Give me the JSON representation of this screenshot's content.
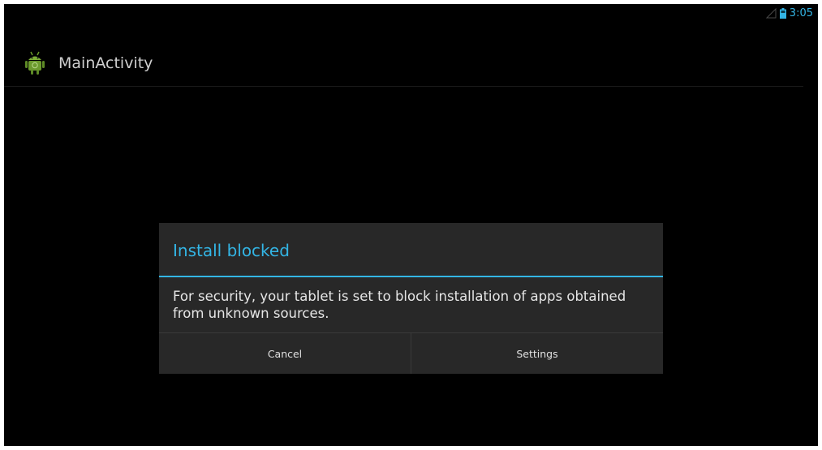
{
  "status_bar": {
    "time": "3:05",
    "icons": [
      "signal-icon",
      "battery-icon"
    ],
    "accent_color": "#33b5e5"
  },
  "action_bar": {
    "icon": "android-icon",
    "title": "MainActivity"
  },
  "dialog": {
    "title": "Install blocked",
    "message": "For security, your tablet is set to block installation of apps obtained from unknown sources.",
    "buttons": {
      "cancel": "Cancel",
      "settings": "Settings"
    },
    "title_color": "#33b5e5",
    "background_color": "#282828"
  }
}
